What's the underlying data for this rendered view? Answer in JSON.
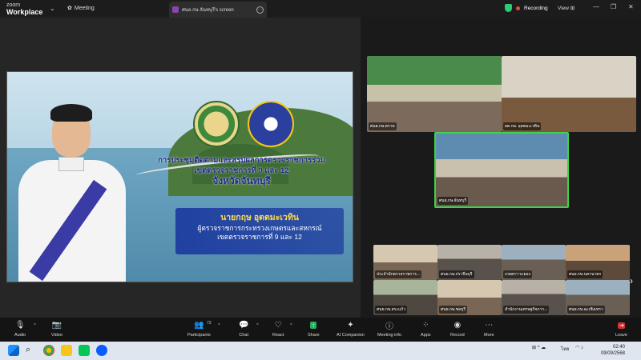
{
  "titlebar": {
    "app_line1": "zoom",
    "app_line2": "Workplace",
    "meeting_label": "Meeting",
    "screen_tab": "ศนย.กษ.จันทบุรี's screen",
    "recording": "Recording",
    "view": "View"
  },
  "slide": {
    "title_line1": "การประชุมติดตามและสรุปผลการตรวจราชการร่วม",
    "title_line2": "เขตตรวจราชการที่ 9 และ 12",
    "title_line3": "จังหวัดจันทบุรี",
    "name": "นายกฤษ อุตตมะเวทิน",
    "role_line1": "ผู้ตรวจราชการกระทรวงเกษตรและสหกรณ์",
    "role_line2": "เขตตรวจราชการที่ 9 และ 12"
  },
  "gallery": {
    "top": [
      {
        "label": "ศนย.กษ.ตราด"
      },
      {
        "label": "ผต.กษ. อุดตมะเวทิน"
      },
      {
        "label": "ศนย.กษ.จันทบุรี"
      }
    ],
    "small": [
      {
        "label": "ประจำนักตรวจราชการ..."
      },
      {
        "label": "ศนย.กษ.ปราจีนบุรี"
      },
      {
        "label": "เกษตรฯ ระยอง"
      },
      {
        "label": "ศนย.กษ.นครนายก"
      },
      {
        "label": "ศนย.กษ.สระแก้ว"
      },
      {
        "label": "ศนย.กษ.ชลบุรี"
      },
      {
        "label": "สำนักงานเศรษฐกิจการ..."
      },
      {
        "label": "ศนย.กษ.ฉะเชิงเทรา"
      }
    ]
  },
  "toolbar": {
    "audio": "Audio",
    "video": "Video",
    "participants": "Participants",
    "participants_count": "73",
    "chat": "Chat",
    "react": "React",
    "share": "Share",
    "ai": "AI Companion",
    "info": "Meeting info",
    "apps": "Apps",
    "record": "Record",
    "more": "More",
    "leave": "Leave"
  },
  "taskbar": {
    "lang": "ไทย",
    "time": "02:40",
    "date": "09/09/2568"
  },
  "colors": {
    "active_border": "#3fd24c",
    "share_green": "#27ae60",
    "leave_red": "#d32f2f",
    "record_dot": "#e74c3c"
  }
}
